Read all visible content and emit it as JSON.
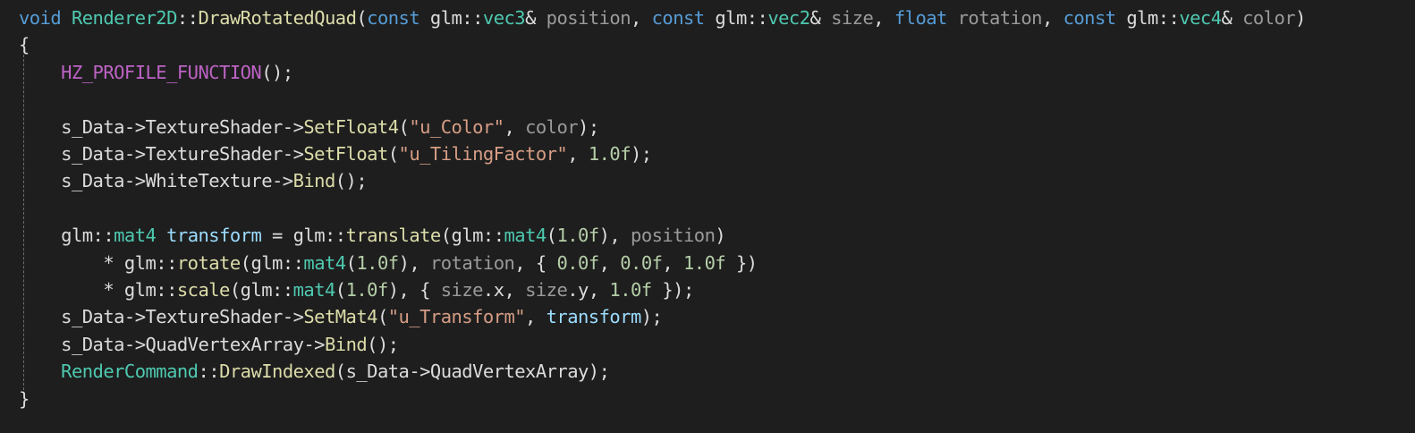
{
  "editor": {
    "background": "#1e1e1e",
    "colors": {
      "keyword": "#569cd6",
      "type": "#4ec9b0",
      "function": "#dcdcaa",
      "macro": "#bd63c5",
      "string": "#d69d85",
      "number": "#b5cea8",
      "parameter": "#9a9a9a",
      "local": "#9cdcfe",
      "plain": "#dcdcdc"
    },
    "lines": [
      [
        {
          "t": "void",
          "k": "kw"
        },
        {
          "t": " ",
          "k": "plain"
        },
        {
          "t": "Renderer2D",
          "k": "type"
        },
        {
          "t": "::",
          "k": "plain"
        },
        {
          "t": "DrawRotatedQuad",
          "k": "fn"
        },
        {
          "t": "(",
          "k": "plain"
        },
        {
          "t": "const",
          "k": "kw"
        },
        {
          "t": " glm::",
          "k": "plain"
        },
        {
          "t": "vec3",
          "k": "type"
        },
        {
          "t": "& ",
          "k": "plain"
        },
        {
          "t": "position",
          "k": "param"
        },
        {
          "t": ", ",
          "k": "plain"
        },
        {
          "t": "const",
          "k": "kw"
        },
        {
          "t": " glm::",
          "k": "plain"
        },
        {
          "t": "vec2",
          "k": "type"
        },
        {
          "t": "& ",
          "k": "plain"
        },
        {
          "t": "size",
          "k": "param"
        },
        {
          "t": ", ",
          "k": "plain"
        },
        {
          "t": "float",
          "k": "kw"
        },
        {
          "t": " ",
          "k": "plain"
        },
        {
          "t": "rotation",
          "k": "param"
        },
        {
          "t": ", ",
          "k": "plain"
        },
        {
          "t": "const",
          "k": "kw"
        },
        {
          "t": " glm::",
          "k": "plain"
        },
        {
          "t": "vec4",
          "k": "type"
        },
        {
          "t": "& ",
          "k": "plain"
        },
        {
          "t": "color",
          "k": "param"
        },
        {
          "t": ")",
          "k": "plain"
        }
      ],
      [
        {
          "t": "{",
          "k": "plain"
        }
      ],
      [
        {
          "t": "    ",
          "k": "plain"
        },
        {
          "t": "HZ_PROFILE_FUNCTION",
          "k": "macro"
        },
        {
          "t": "();",
          "k": "plain"
        }
      ],
      [],
      [
        {
          "t": "    s_Data->TextureShader->",
          "k": "plain"
        },
        {
          "t": "SetFloat4",
          "k": "fn"
        },
        {
          "t": "(",
          "k": "plain"
        },
        {
          "t": "\"u_Color\"",
          "k": "str"
        },
        {
          "t": ", ",
          "k": "plain"
        },
        {
          "t": "color",
          "k": "param"
        },
        {
          "t": ");",
          "k": "plain"
        }
      ],
      [
        {
          "t": "    s_Data->TextureShader->",
          "k": "plain"
        },
        {
          "t": "SetFloat",
          "k": "fn"
        },
        {
          "t": "(",
          "k": "plain"
        },
        {
          "t": "\"u_TilingFactor\"",
          "k": "str"
        },
        {
          "t": ", ",
          "k": "plain"
        },
        {
          "t": "1.0f",
          "k": "num"
        },
        {
          "t": ");",
          "k": "plain"
        }
      ],
      [
        {
          "t": "    s_Data->WhiteTexture->",
          "k": "plain"
        },
        {
          "t": "Bind",
          "k": "fn"
        },
        {
          "t": "();",
          "k": "plain"
        }
      ],
      [],
      [
        {
          "t": "    glm::",
          "k": "plain"
        },
        {
          "t": "mat4",
          "k": "type"
        },
        {
          "t": " ",
          "k": "plain"
        },
        {
          "t": "transform",
          "k": "var"
        },
        {
          "t": " = glm::",
          "k": "plain"
        },
        {
          "t": "translate",
          "k": "fn"
        },
        {
          "t": "(glm::",
          "k": "plain"
        },
        {
          "t": "mat4",
          "k": "type"
        },
        {
          "t": "(",
          "k": "plain"
        },
        {
          "t": "1.0f",
          "k": "num"
        },
        {
          "t": "), ",
          "k": "plain"
        },
        {
          "t": "position",
          "k": "param"
        },
        {
          "t": ")",
          "k": "plain"
        }
      ],
      [
        {
          "t": "        * glm::",
          "k": "plain"
        },
        {
          "t": "rotate",
          "k": "fn"
        },
        {
          "t": "(glm::",
          "k": "plain"
        },
        {
          "t": "mat4",
          "k": "type"
        },
        {
          "t": "(",
          "k": "plain"
        },
        {
          "t": "1.0f",
          "k": "num"
        },
        {
          "t": "), ",
          "k": "plain"
        },
        {
          "t": "rotation",
          "k": "param"
        },
        {
          "t": ", { ",
          "k": "plain"
        },
        {
          "t": "0.0f",
          "k": "num"
        },
        {
          "t": ", ",
          "k": "plain"
        },
        {
          "t": "0.0f",
          "k": "num"
        },
        {
          "t": ", ",
          "k": "plain"
        },
        {
          "t": "1.0f",
          "k": "num"
        },
        {
          "t": " })",
          "k": "plain"
        }
      ],
      [
        {
          "t": "        * glm::",
          "k": "plain"
        },
        {
          "t": "scale",
          "k": "fn"
        },
        {
          "t": "(glm::",
          "k": "plain"
        },
        {
          "t": "mat4",
          "k": "type"
        },
        {
          "t": "(",
          "k": "plain"
        },
        {
          "t": "1.0f",
          "k": "num"
        },
        {
          "t": "), { ",
          "k": "plain"
        },
        {
          "t": "size",
          "k": "param"
        },
        {
          "t": ".x, ",
          "k": "plain"
        },
        {
          "t": "size",
          "k": "param"
        },
        {
          "t": ".y, ",
          "k": "plain"
        },
        {
          "t": "1.0f",
          "k": "num"
        },
        {
          "t": " });",
          "k": "plain"
        }
      ],
      [
        {
          "t": "    s_Data->TextureShader->",
          "k": "plain"
        },
        {
          "t": "SetMat4",
          "k": "fn"
        },
        {
          "t": "(",
          "k": "plain"
        },
        {
          "t": "\"u_Transform\"",
          "k": "str"
        },
        {
          "t": ", ",
          "k": "plain"
        },
        {
          "t": "transform",
          "k": "var"
        },
        {
          "t": ");",
          "k": "plain"
        }
      ],
      [
        {
          "t": "    s_Data->QuadVertexArray->",
          "k": "plain"
        },
        {
          "t": "Bind",
          "k": "fn"
        },
        {
          "t": "();",
          "k": "plain"
        }
      ],
      [
        {
          "t": "    ",
          "k": "plain"
        },
        {
          "t": "RenderCommand",
          "k": "type"
        },
        {
          "t": "::",
          "k": "plain"
        },
        {
          "t": "DrawIndexed",
          "k": "fn"
        },
        {
          "t": "(s_Data->QuadVertexArray);",
          "k": "plain"
        }
      ],
      [
        {
          "t": "}",
          "k": "plain"
        }
      ]
    ]
  }
}
